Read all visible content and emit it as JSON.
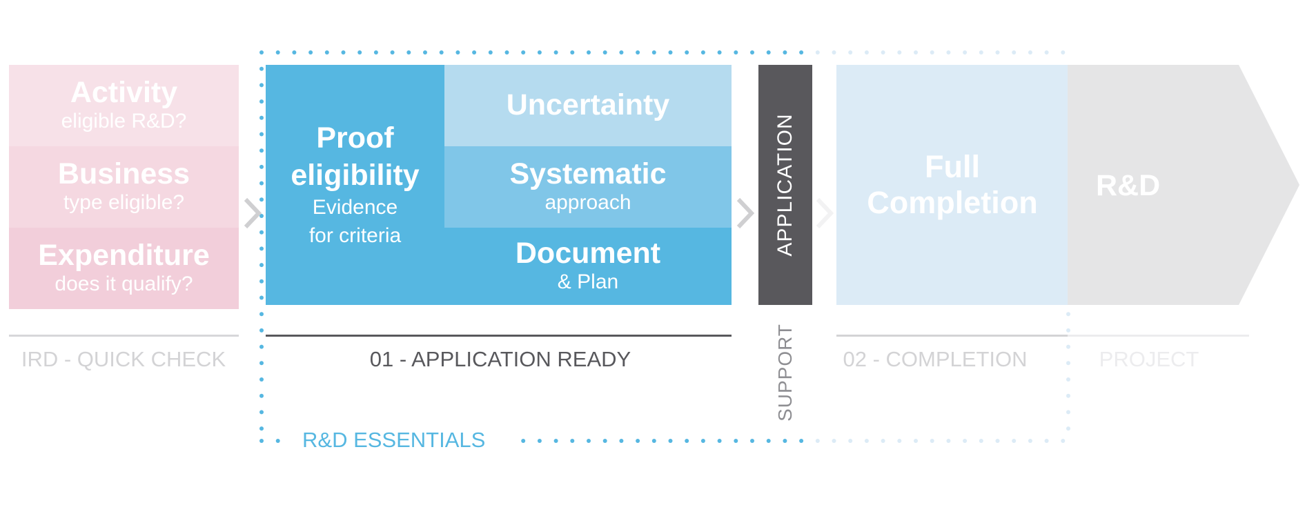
{
  "colors": {
    "accent_blue": "#56b7e1",
    "light_blue": "#b5dbef",
    "mid_blue": "#80c6e8",
    "pale_blue": "#dcebf6",
    "pink_1": "#f7e1e8",
    "pink_2": "#f5d8e1",
    "pink_3": "#f2ceda",
    "dark_gray": "#59585c",
    "light_gray": "#e5e5e6"
  },
  "quick_check": {
    "items": [
      {
        "title": "Activity",
        "subtitle": "eligible R&D?"
      },
      {
        "title": "Business",
        "subtitle": "type eligible?"
      },
      {
        "title": "Expenditure",
        "subtitle": "does it qualify?"
      }
    ],
    "label": "IRD - QUICK CHECK"
  },
  "application_ready": {
    "proof": {
      "title_line1": "Proof",
      "title_line2": "eligibility",
      "sub_line1": "Evidence",
      "sub_line2": "for criteria"
    },
    "items": [
      {
        "title": "Uncertainty",
        "subtitle": ""
      },
      {
        "title": "Systematic",
        "subtitle": "approach"
      },
      {
        "title": "Document",
        "subtitle": "& Plan"
      }
    ],
    "label": "01 - APPLICATION READY"
  },
  "application_bar": {
    "label": "APPLICATION",
    "support_label": "SUPPORT"
  },
  "completion": {
    "title_line1": "Full",
    "title_line2": "Completion",
    "label": "02 - COMPLETION"
  },
  "project": {
    "title": "R&D",
    "label": "PROJECT"
  },
  "essentials_box": {
    "label": "R&D ESSENTIALS"
  },
  "icons": {
    "arrow_1": "chevron-right-icon",
    "arrow_2": "chevron-right-icon",
    "arrow_3": "chevron-right-icon"
  }
}
